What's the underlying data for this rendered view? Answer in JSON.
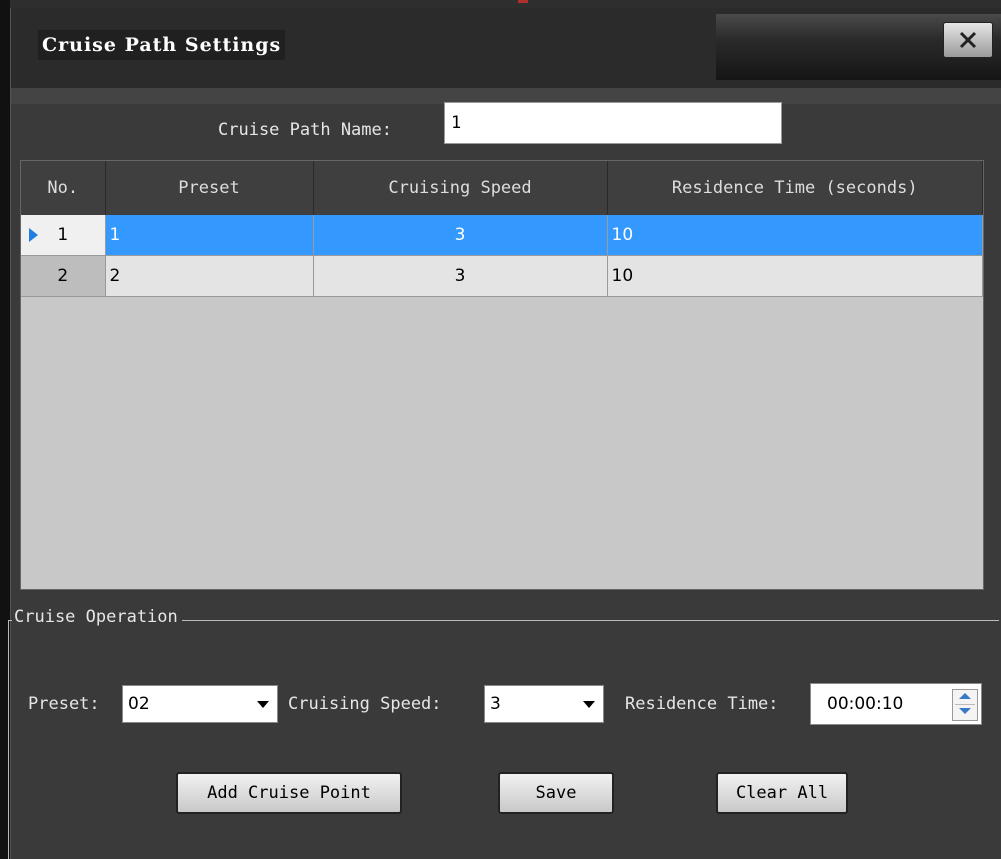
{
  "window": {
    "title": "Cruise Path Settings",
    "close_label": "✕"
  },
  "path_name": {
    "label": "Cruise Path Name:",
    "value": "1"
  },
  "table": {
    "columns": [
      "No.",
      "Preset",
      "Cruising Speed",
      "Residence Time (seconds)"
    ],
    "rows": [
      {
        "no": "1",
        "preset": "1",
        "speed": "3",
        "time": "10",
        "selected": true
      },
      {
        "no": "2",
        "preset": "2",
        "speed": "3",
        "time": "10",
        "selected": false
      }
    ]
  },
  "operation": {
    "legend": "Cruise Operation",
    "preset_label": "Preset:",
    "preset_value": "02",
    "speed_label": "Cruising Speed:",
    "speed_value": "3",
    "residence_label": "Residence Time:",
    "residence_value": "00:00:10",
    "add_label": "Add Cruise Point",
    "save_label": "Save",
    "clear_label": "Clear All"
  },
  "colors": {
    "selection": "#3399ff",
    "window_bg": "#3a3a3a"
  }
}
